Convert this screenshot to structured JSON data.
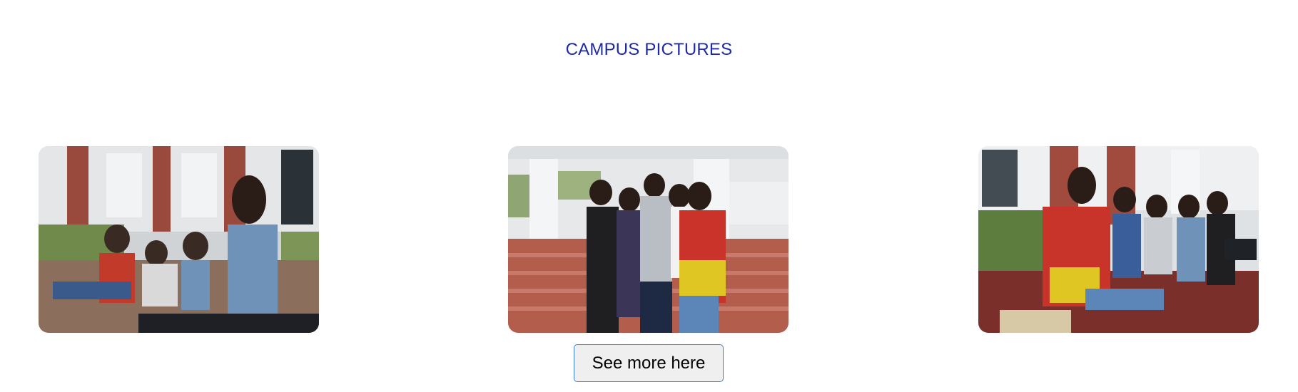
{
  "section": {
    "title": "CAMPUS PICTURES"
  },
  "gallery": {
    "images": [
      {
        "alt": "Students studying with laptops outside a campus building",
        "icon": "photo"
      },
      {
        "alt": "Group of students posing on campus steps",
        "icon": "photo"
      },
      {
        "alt": "Students reading and using laptops on a bench",
        "icon": "photo"
      }
    ]
  },
  "actions": {
    "see_more_label": "See more here"
  },
  "colors": {
    "title": "#1f2aa8",
    "button_border": "#3d7fe0",
    "button_bg": "#efefef"
  }
}
